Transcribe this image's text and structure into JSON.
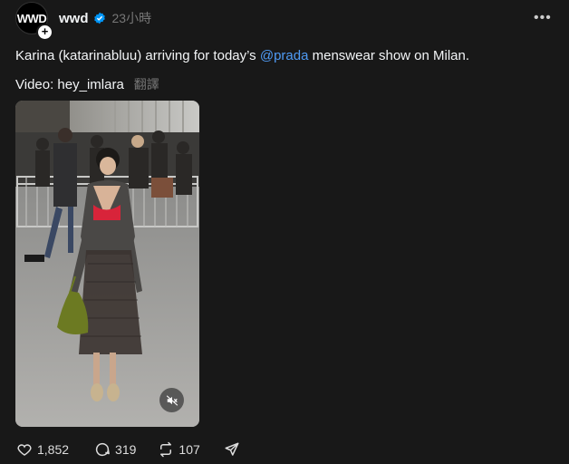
{
  "post": {
    "avatar_text": "WWD",
    "username": "wwd",
    "timestamp": "23小時",
    "caption_pre": "Karina (katarinabluu) arriving for today’s ",
    "caption_mention": "@prada",
    "caption_post": " menswear show on Milan.",
    "credit": "Video: hey_imlara",
    "translate_label": "翻譯"
  },
  "actions": {
    "likes": "1,852",
    "comments": "319",
    "reposts": "107"
  },
  "colors": {
    "background": "#181818",
    "mention": "#4f9bf5",
    "verified": "#0095f6"
  },
  "icons": [
    "plus-icon",
    "verified-badge-icon",
    "more-icon",
    "mute-icon",
    "heart-icon",
    "comment-icon",
    "repost-icon",
    "share-icon"
  ]
}
